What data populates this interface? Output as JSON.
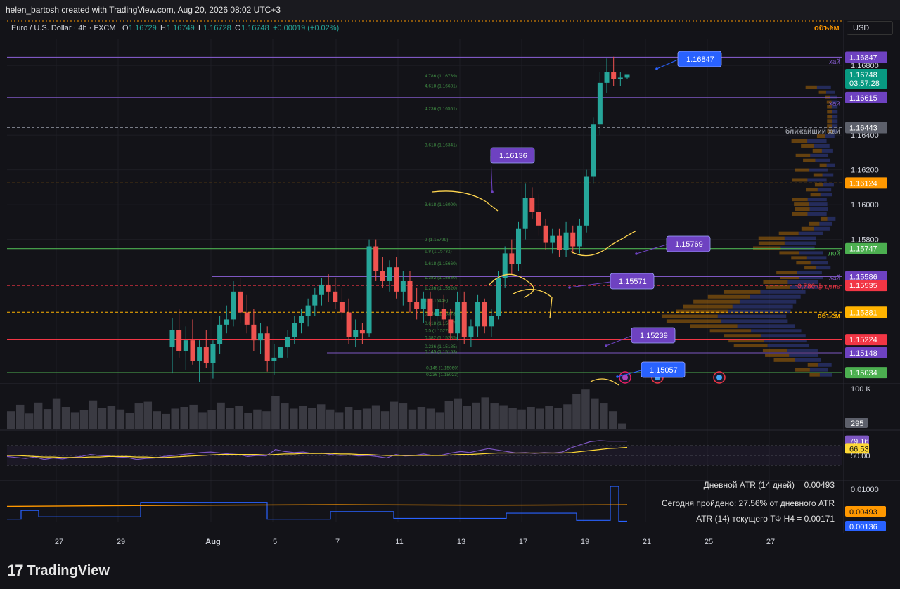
{
  "header": {
    "credit": "helen_bartosh created with TradingView.com, Aug 20, 2026 08:02 UTC+3",
    "symbol": "Euro / U.S. Dollar · 4h · FXCM",
    "o_label": "O",
    "o_val": "1.16729",
    "h_label": "H",
    "h_val": "1.16749",
    "l_label": "L",
    "l_val": "1.16728",
    "c_label": "C",
    "c_val": "1.16748",
    "change": "+0.00019 (+0.02%)",
    "currency": "USD",
    "volume_label": "объём"
  },
  "price_labels": [
    {
      "text": "1.16847",
      "price": 1.16847,
      "bg": "#6e42c1"
    },
    {
      "text": "1.16748",
      "price": 1.16748,
      "bg": "#089981",
      "sub": "03:57:28"
    },
    {
      "text": "1.16615",
      "price": 1.16615,
      "bg": "#6e42c1"
    },
    {
      "text": "1.16443",
      "price": 1.16443,
      "bg": "#5d606b"
    },
    {
      "text": "1.16124",
      "price": 1.16124,
      "bg": "#ff9800"
    },
    {
      "text": "1.15747",
      "price": 1.15747,
      "bg": "#4caf50"
    },
    {
      "text": "1.15586",
      "price": 1.15586,
      "bg": "#6e42c1"
    },
    {
      "text": "1.15535",
      "price": 1.15535,
      "bg": "#f23645"
    },
    {
      "text": "1.15381",
      "price": 1.15381,
      "bg": "#ffb300"
    },
    {
      "text": "1.15224",
      "price": 1.15224,
      "bg": "#f23645"
    },
    {
      "text": "1.15148",
      "price": 1.15148,
      "bg": "#6e42c1"
    },
    {
      "text": "1.15034",
      "price": 1.15034,
      "bg": "#4caf50"
    }
  ],
  "price_ticks": [
    "1.16800",
    "1.16400",
    "1.16200",
    "1.16000",
    "1.15800"
  ],
  "right_notes": [
    {
      "text": "хай",
      "price": 1.168,
      "color": "#7e57c2"
    },
    {
      "text": "хай",
      "price": 1.1656,
      "color": "#7e57c2"
    },
    {
      "text": "ближайший хай",
      "price": 1.164,
      "color": "#9598a1"
    },
    {
      "text": "лой",
      "price": 1.157,
      "color": "#4caf50"
    },
    {
      "text": "хай",
      "price": 1.1556,
      "color": "#7e57c2"
    },
    {
      "text": "0,786 ф день",
      "price": 1.1551,
      "color": "#f23645"
    },
    {
      "text": "объём",
      "price": 1.1534,
      "color": "#ffb300"
    }
  ],
  "callouts": [
    {
      "text": "1.16847",
      "price": 1.16847,
      "color": "#2962ff"
    },
    {
      "text": "1.16136",
      "price": 1.16136,
      "color": "#6e42c1"
    },
    {
      "text": "1.15769",
      "price": 1.15769,
      "color": "#6e42c1"
    },
    {
      "text": "1.15571",
      "price": 1.15571,
      "color": "#6e42c1"
    },
    {
      "text": "1.15239",
      "price": 1.15239,
      "color": "#6e42c1"
    },
    {
      "text": "1.15057",
      "price": 1.15057,
      "color": "#2962ff"
    }
  ],
  "fib_levels": [
    {
      "text": "4.786 (1.16739)",
      "price": 1.16739
    },
    {
      "text": "4.618 (1.16681)",
      "price": 1.16681
    },
    {
      "text": "4.236 (1.16551)",
      "price": 1.16551
    },
    {
      "text": "3.618 (1.16341)",
      "price": 1.16341
    },
    {
      "text": "3.618 (1.16000)",
      "price": 1.16
    },
    {
      "text": "2 (1.15799)",
      "price": 1.15799
    },
    {
      "text": "1.8 (1.15732)",
      "price": 1.15732
    },
    {
      "text": "1.618 (1.15660)",
      "price": 1.1566
    },
    {
      "text": "1.382 (1.15580)",
      "price": 1.1558
    },
    {
      "text": "1.236 (1.15520)",
      "price": 1.1552
    },
    {
      "text": "1 (1.15449)",
      "price": 1.15449
    },
    {
      "text": "0.786 (1.15373)",
      "price": 1.15373
    },
    {
      "text": "0.618 (1.15317)",
      "price": 1.15317
    },
    {
      "text": "0.5 (1.15276)",
      "price": 1.15276
    },
    {
      "text": "0.382 (1.15235)",
      "price": 1.15235
    },
    {
      "text": "0.236 (1.15185)",
      "price": 1.15185
    },
    {
      "text": "0.145 (1.15153)",
      "price": 1.15153
    },
    {
      "text": "-0.145 (1.15060)",
      "price": 1.1506
    },
    {
      "text": "-0.236 (1.15023)",
      "price": 1.15023
    }
  ],
  "volume_pane": {
    "max_label": "100 K",
    "last_label": "295"
  },
  "rsi_pane": {
    "rsi_label": "79.16",
    "ma_label": "66.53",
    "mid_label": "50.00"
  },
  "atr_pane": {
    "line1": "Дневной ATR (14 дней) = 0.00493",
    "line2": "Сегодня пройдено: 27.56% от дневного ATR",
    "line3": "ATR (14) текущего ТФ H4 = 0.00171",
    "top_label": "0.01000",
    "daily_label": "0.00493",
    "tf_label": "0.00136"
  },
  "x_axis": [
    "27",
    "29",
    "Aug",
    "5",
    "7",
    "11",
    "13",
    "17",
    "19",
    "21",
    "25",
    "27"
  ],
  "footer": {
    "brand": "TradingView",
    "mark": "17"
  },
  "chart_data": {
    "type": "candlestick",
    "symbol": "EURUSD",
    "timeframe": "4h",
    "ylim": [
      1.1497,
      1.1695
    ],
    "candles": [
      [
        1.1518,
        1.1535,
        1.1503,
        1.1528
      ],
      [
        1.1528,
        1.154,
        1.1512,
        1.1516
      ],
      [
        1.1516,
        1.153,
        1.1505,
        1.1522
      ],
      [
        1.1522,
        1.1534,
        1.1508,
        1.151
      ],
      [
        1.151,
        1.1522,
        1.1498,
        1.1518
      ],
      [
        1.1518,
        1.1528,
        1.1506,
        1.1509
      ],
      [
        1.1509,
        1.1522,
        1.15,
        1.152
      ],
      [
        1.152,
        1.1536,
        1.1514,
        1.1531
      ],
      [
        1.1531,
        1.1542,
        1.1526,
        1.1534
      ],
      [
        1.1534,
        1.1556,
        1.153,
        1.155
      ],
      [
        1.155,
        1.1558,
        1.1532,
        1.1538
      ],
      [
        1.1538,
        1.1548,
        1.1526,
        1.1531
      ],
      [
        1.1531,
        1.154,
        1.1516,
        1.1522
      ],
      [
        1.1522,
        1.1532,
        1.1514,
        1.1526
      ],
      [
        1.1526,
        1.153,
        1.1504,
        1.151
      ],
      [
        1.151,
        1.152,
        1.1502,
        1.1512
      ],
      [
        1.1512,
        1.1522,
        1.1506,
        1.1518
      ],
      [
        1.1518,
        1.1528,
        1.1512,
        1.1524
      ],
      [
        1.1524,
        1.1536,
        1.152,
        1.1532
      ],
      [
        1.1532,
        1.154,
        1.1526,
        1.1536
      ],
      [
        1.1536,
        1.1546,
        1.153,
        1.1542
      ],
      [
        1.1542,
        1.1552,
        1.1536,
        1.1548
      ],
      [
        1.1548,
        1.1558,
        1.1542,
        1.1554
      ],
      [
        1.1554,
        1.156,
        1.1544,
        1.155
      ],
      [
        1.155,
        1.1558,
        1.154,
        1.1544
      ],
      [
        1.1544,
        1.1552,
        1.1534,
        1.1538
      ],
      [
        1.1538,
        1.1546,
        1.152,
        1.1524
      ],
      [
        1.1524,
        1.1534,
        1.1518,
        1.1528
      ],
      [
        1.1528,
        1.1532,
        1.152,
        1.1526
      ],
      [
        1.1526,
        1.158,
        1.1524,
        1.1576
      ],
      [
        1.1576,
        1.158,
        1.1556,
        1.1562
      ],
      [
        1.1562,
        1.157,
        1.1552,
        1.1556
      ],
      [
        1.1556,
        1.1568,
        1.155,
        1.1564
      ],
      [
        1.1564,
        1.157,
        1.1546,
        1.155
      ],
      [
        1.155,
        1.1562,
        1.1542,
        1.1556
      ],
      [
        1.1556,
        1.1562,
        1.1538,
        1.1544
      ],
      [
        1.1544,
        1.1552,
        1.1534,
        1.154
      ],
      [
        1.154,
        1.155,
        1.1532,
        1.1546
      ],
      [
        1.1546,
        1.155,
        1.153,
        1.1536
      ],
      [
        1.1536,
        1.1546,
        1.1528,
        1.154
      ],
      [
        1.154,
        1.1548,
        1.153,
        1.1534
      ],
      [
        1.1534,
        1.154,
        1.1522,
        1.1526
      ],
      [
        1.1526,
        1.155,
        1.1522,
        1.1544
      ],
      [
        1.1544,
        1.155,
        1.152,
        1.1524
      ],
      [
        1.1524,
        1.1534,
        1.1518,
        1.153
      ],
      [
        1.153,
        1.1548,
        1.1524,
        1.1544
      ],
      [
        1.1544,
        1.1546,
        1.1526,
        1.153
      ],
      [
        1.153,
        1.154,
        1.1524,
        1.1536
      ],
      [
        1.1536,
        1.1562,
        1.1534,
        1.1558
      ],
      [
        1.1558,
        1.1576,
        1.1552,
        1.1572
      ],
      [
        1.1572,
        1.158,
        1.156,
        1.1566
      ],
      [
        1.1566,
        1.159,
        1.1562,
        1.1586
      ],
      [
        1.1586,
        1.1612,
        1.158,
        1.1604
      ],
      [
        1.1604,
        1.161,
        1.1592,
        1.1596
      ],
      [
        1.1596,
        1.1606,
        1.1582,
        1.1588
      ],
      [
        1.1588,
        1.1592,
        1.1574,
        1.1578
      ],
      [
        1.1578,
        1.1586,
        1.1572,
        1.1582
      ],
      [
        1.1582,
        1.1586,
        1.157,
        1.1574
      ],
      [
        1.1574,
        1.159,
        1.157,
        1.1584
      ],
      [
        1.1584,
        1.1588,
        1.1572,
        1.1576
      ],
      [
        1.1576,
        1.1592,
        1.1572,
        1.1588
      ],
      [
        1.1588,
        1.162,
        1.1584,
        1.1616
      ],
      [
        1.1616,
        1.165,
        1.1612,
        1.1646
      ],
      [
        1.1646,
        1.1676,
        1.164,
        1.167
      ],
      [
        1.167,
        1.1684,
        1.1664,
        1.1676
      ],
      [
        1.1676,
        1.1685,
        1.1668,
        1.1672
      ],
      [
        1.1672,
        1.1676,
        1.1668,
        1.1673
      ],
      [
        1.1673,
        1.1675,
        1.1672,
        1.1675
      ]
    ],
    "volume": [
      40,
      55,
      35,
      60,
      45,
      70,
      50,
      38,
      42,
      65,
      48,
      52,
      44,
      36,
      58,
      62,
      40,
      34,
      46,
      50,
      55,
      38,
      42,
      60,
      48,
      52,
      36,
      44,
      40,
      75,
      58,
      46,
      52,
      48,
      56,
      44,
      38,
      50,
      42,
      46,
      54,
      40,
      62,
      58,
      44,
      50,
      46,
      38,
      64,
      70,
      52,
      60,
      72,
      58,
      54,
      48,
      44,
      50,
      46,
      52,
      48,
      56,
      80,
      90,
      70,
      58,
      40,
      12
    ],
    "rsi": [
      48,
      46,
      44,
      47,
      42,
      45,
      43,
      46,
      48,
      52,
      50,
      49,
      47,
      46,
      42,
      44,
      45,
      48,
      50,
      52,
      54,
      56,
      57,
      55,
      53,
      52,
      48,
      50,
      49,
      62,
      58,
      56,
      57,
      54,
      55,
      52,
      50,
      51,
      49,
      50,
      48,
      45,
      52,
      49,
      50,
      53,
      50,
      51,
      55,
      58,
      56,
      60,
      64,
      61,
      58,
      55,
      56,
      54,
      56,
      55,
      57,
      66,
      72,
      78,
      80,
      79,
      79,
      79
    ],
    "rsi_ma": [
      50,
      50,
      49,
      48,
      47,
      47,
      46,
      46,
      46,
      47,
      47,
      48,
      48,
      48,
      47,
      47,
      46,
      46,
      47,
      48,
      49,
      50,
      51,
      52,
      52,
      52,
      52,
      52,
      51,
      52,
      53,
      53,
      54,
      54,
      54,
      54,
      53,
      53,
      52,
      52,
      51,
      50,
      50,
      50,
      50,
      50,
      50,
      50,
      51,
      52,
      52,
      53,
      54,
      55,
      55,
      55,
      55,
      55,
      55,
      55,
      55,
      56,
      58,
      60,
      62,
      64,
      65,
      66.5
    ],
    "atr_series": {
      "daily": 0.00493,
      "tf_h4": 0.00171,
      "last_tf": 0.00136
    }
  }
}
